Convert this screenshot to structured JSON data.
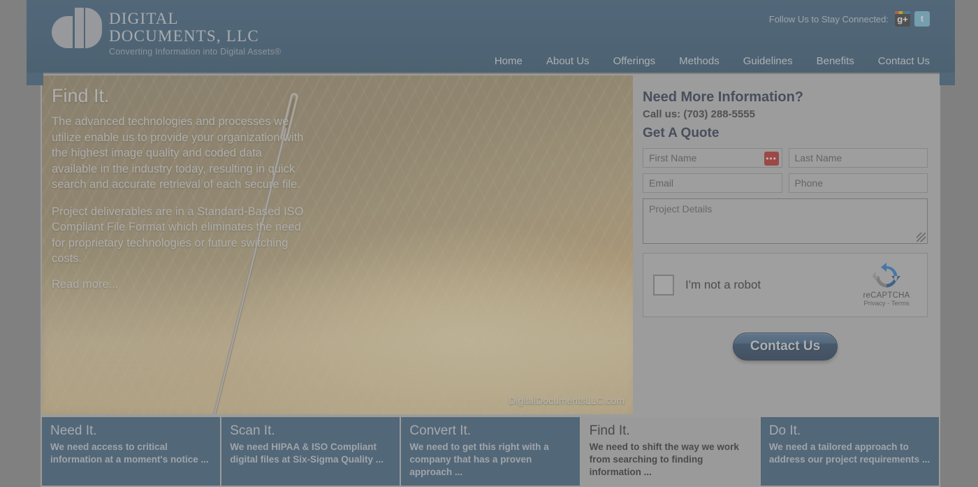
{
  "header": {
    "logo": {
      "line1": "DIGITAL",
      "line2": "DOCUMENTS, LLC",
      "tagline": "Converting Information into Digital Assets®",
      "mark_icon": "dd-monogram-icon"
    },
    "social": {
      "follow_text": "Follow Us to Stay Connected:",
      "google_plus_label": "g+",
      "twitter_label": "t"
    },
    "nav": [
      {
        "label": "Home"
      },
      {
        "label": "About Us"
      },
      {
        "label": "Offerings"
      },
      {
        "label": "Methods"
      },
      {
        "label": "Guidelines"
      },
      {
        "label": "Benefits"
      },
      {
        "label": "Contact Us"
      }
    ]
  },
  "hero": {
    "title": "Find It.",
    "paragraph1": "The advanced technologies and processes we utilize enable us to provide your organization with the highest image quality and coded data available in the industry today, resulting in quick search and accurate retrieval of each secure file.",
    "paragraph2": "Project deliverables are in a Standard-Based ISO Compliant File Format which eliminates the need for proprietary technologies or future switching costs.",
    "read_more": "Read more...",
    "watermark": "DigitalDocumentsLLC.com"
  },
  "form": {
    "heading": "Need More Information?",
    "call_us": "Call us: (703) 288-5555",
    "quote_heading": "Get A Quote",
    "fields": {
      "first_name_placeholder": "First Name",
      "last_name_placeholder": "Last Name",
      "email_placeholder": "Email",
      "phone_placeholder": "Phone",
      "project_details_placeholder": "Project Details"
    },
    "password_manager_icon": "password-manager-icon",
    "recaptcha": {
      "checkbox_label": "I'm not a robot",
      "brand": "reCAPTCHA",
      "terms": "Privacy - Terms",
      "logo_icon": "recaptcha-logo-icon"
    },
    "submit_label": "Contact Us"
  },
  "cards": [
    {
      "title": "Need It.",
      "body": "We need access to critical information at a moment's notice ...",
      "active": false
    },
    {
      "title": "Scan It.",
      "body": "We need HIPAA & ISO Compliant digital files at Six-Sigma Quality ...",
      "active": false
    },
    {
      "title": "Convert It.",
      "body": "We need to get this right with a company that has a proven approach ...",
      "active": false
    },
    {
      "title": "Find It.",
      "body": "We need to shift the way we work from searching to finding information ...",
      "active": true
    },
    {
      "title": "Do It.",
      "body": "We need a tailored approach to address our project requirements ...",
      "active": false
    }
  ],
  "colors": {
    "brand_blue": "#2c5272",
    "logo_gray": "#a9aeb3",
    "page_overlay_gray": "#808080",
    "recaptcha_blue": "#1b6fc4",
    "password_manager_red": "#b01c17"
  }
}
